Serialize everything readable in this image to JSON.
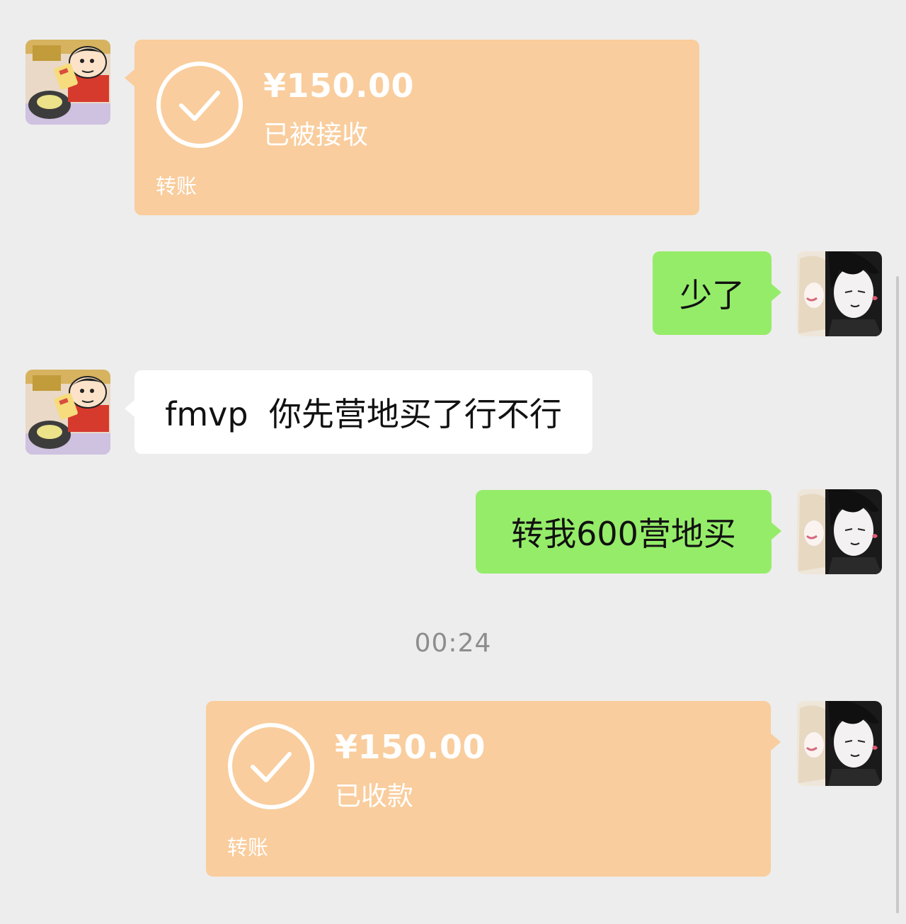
{
  "colors": {
    "background": "#ededed",
    "sent_bubble": "#95ec69",
    "received_bubble": "#ffffff",
    "transfer_bubble": "#f9cd9d",
    "timestamp": "#8d8d8d"
  },
  "messages": [
    {
      "sender": "contact",
      "type": "transfer",
      "amount": "¥150.00",
      "status": "已被接收",
      "label": "转账",
      "icon": "check-circle-icon"
    },
    {
      "sender": "me",
      "type": "text",
      "text": "少了"
    },
    {
      "sender": "contact",
      "type": "text",
      "text": "fmvp  你先营地买了行不行"
    },
    {
      "sender": "me",
      "type": "text",
      "text": "转我600营地买"
    },
    {
      "type": "timestamp",
      "text": "00:24"
    },
    {
      "sender": "me",
      "type": "transfer",
      "amount": "¥150.00",
      "status": "已收款",
      "label": "转账",
      "icon": "check-circle-icon"
    }
  ]
}
